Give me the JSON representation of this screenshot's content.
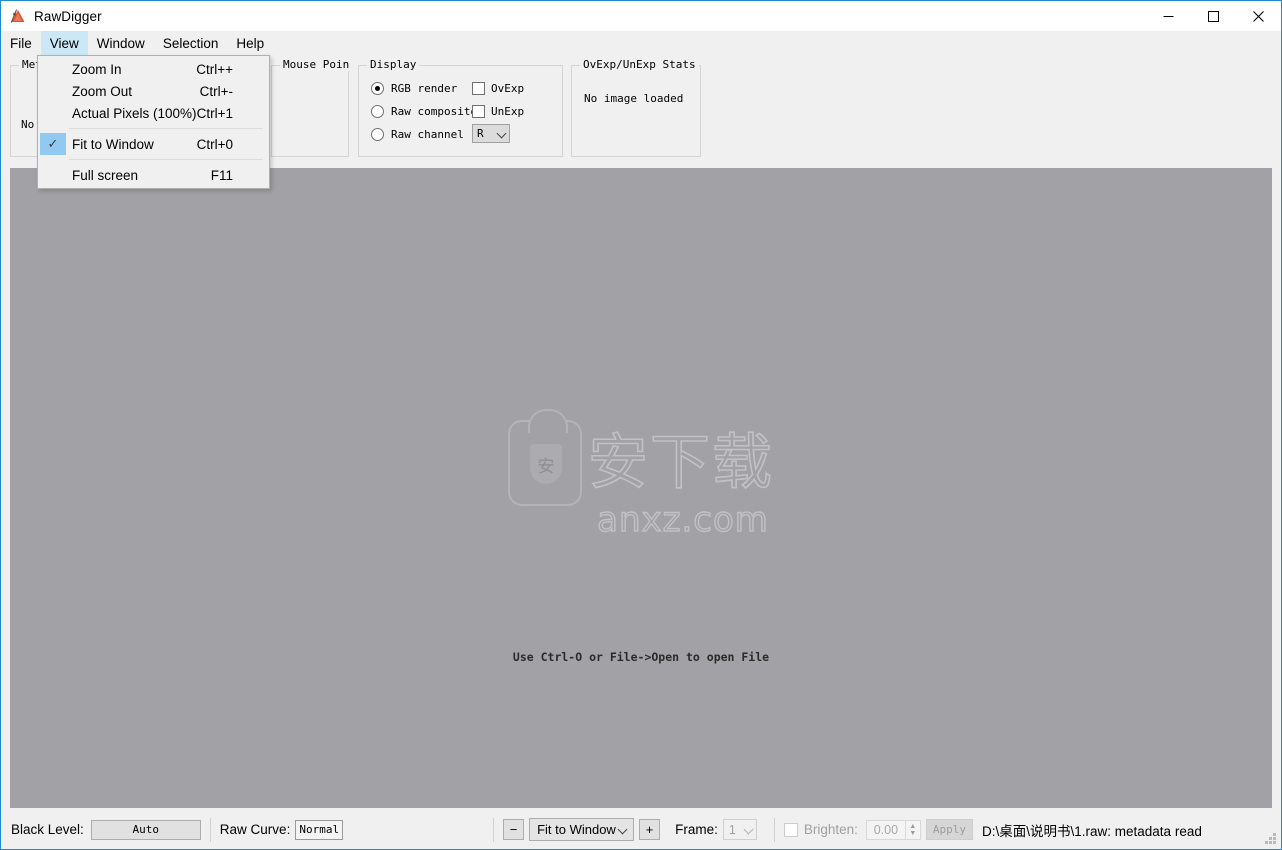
{
  "window": {
    "title": "RawDigger",
    "icon": "rawdigger-triangle-icon",
    "minimize_label": "—",
    "maximize_label": "□",
    "close_label": "✕"
  },
  "menubar": {
    "items": [
      {
        "label": "File",
        "active": false
      },
      {
        "label": "View",
        "active": true
      },
      {
        "label": "Window",
        "active": false
      },
      {
        "label": "Selection",
        "active": false
      },
      {
        "label": "Help",
        "active": false
      }
    ]
  },
  "view_menu": {
    "items": [
      {
        "label": "Zoom In",
        "accel": "Ctrl++",
        "checked": false
      },
      {
        "label": "Zoom Out",
        "accel": "Ctrl+-",
        "checked": false
      },
      {
        "label": "Actual Pixels (100%)",
        "accel": "Ctrl+1",
        "checked": false
      },
      {
        "label": "Fit to Window",
        "accel": "Ctrl+0",
        "checked": true
      },
      {
        "label": "Full screen",
        "accel": "F11",
        "checked": false
      }
    ],
    "check_glyph": "✓"
  },
  "panels": {
    "metadata": {
      "title": "Met",
      "body": "No"
    },
    "mouse_point": {
      "title": "Mouse Poin",
      "body": ""
    },
    "display": {
      "title": "Display",
      "radios": [
        {
          "label": "RGB render",
          "checked": true
        },
        {
          "label": "Raw composite",
          "checked": false
        },
        {
          "label": "Raw channel",
          "checked": false
        }
      ],
      "checkboxes": [
        {
          "label": "OvExp",
          "checked": false
        },
        {
          "label": "UnExp",
          "checked": false
        }
      ],
      "channel_select": {
        "value": "R"
      }
    },
    "stats": {
      "title": "OvExp/UnExp Stats",
      "body": "No image loaded"
    }
  },
  "canvas": {
    "hint": "Use Ctrl-O or File->Open to open File",
    "watermark": {
      "shield_char": "安",
      "cn_text": "安下载",
      "latin_text": "anxz.com"
    },
    "background_color": "#a2a2a6"
  },
  "statusbar": {
    "black_level_label": "Black Level:",
    "black_level_value": "Auto",
    "raw_curve_label": "Raw Curve:",
    "raw_curve_value": "Normal",
    "zoom_out_label": "−",
    "zoom_value": "Fit to Window",
    "zoom_in_label": "+",
    "frame_label": "Frame:",
    "frame_value": "1",
    "brighten_label": "Brighten:",
    "brighten_value": "0.00",
    "brighten_checked": false,
    "apply_label": "Apply",
    "message": "D:\\桌面\\说明书\\1.raw: metadata read"
  },
  "colors": {
    "accent_border": "#1d8ad2",
    "menu_highlight": "#cce8f7",
    "check_highlight": "#91c9f0",
    "chrome": "#f0f0f0",
    "canvas": "#a2a2a6"
  }
}
